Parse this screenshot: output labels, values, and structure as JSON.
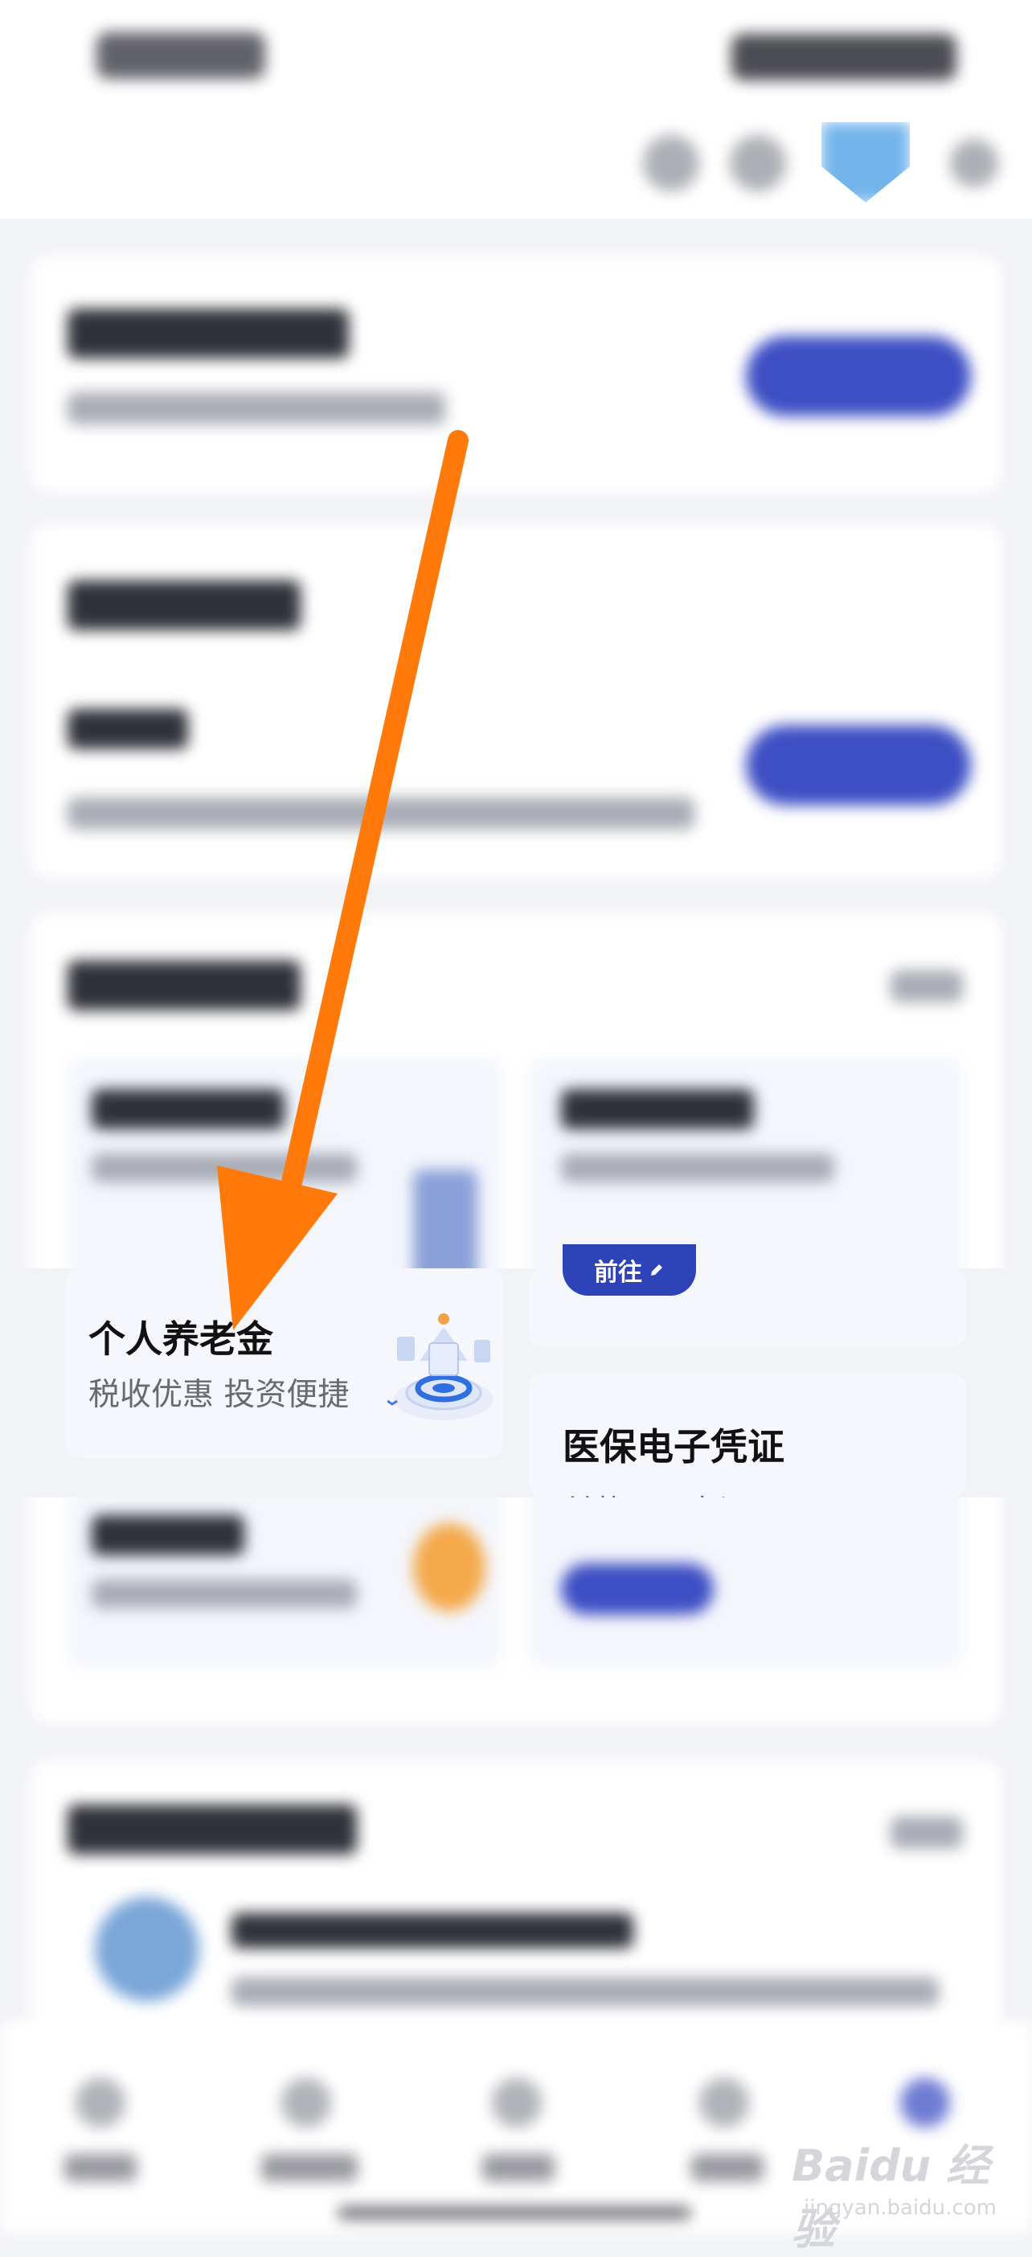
{
  "pension_tile": {
    "title": "个人养老金",
    "subtitle": "税收优惠 投资便捷"
  },
  "medical_tile": {
    "title": "医保电子凭证",
    "subtitle": "付款码 · 查记录"
  },
  "goto_button": {
    "label": "前往",
    "icon": "pencil-icon"
  },
  "watermark": {
    "text": "Baidu 经验",
    "sub": "jingyan.baidu.com"
  },
  "colors": {
    "accent": "#3e4fc4",
    "arrow": "#ff7a0a",
    "background": "#f2f3f7"
  }
}
